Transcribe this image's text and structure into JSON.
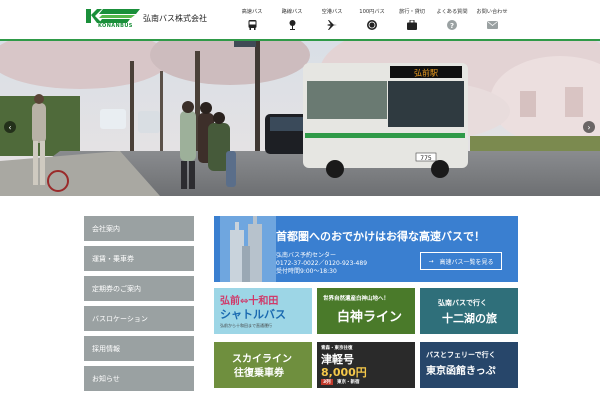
{
  "header": {
    "logo_text": "KONANBUS",
    "company_name": "弘南バス株式会社",
    "nav": [
      {
        "label": "高速バス",
        "icon": "bus-icon"
      },
      {
        "label": "路線バス",
        "icon": "bus-stop-icon"
      },
      {
        "label": "空港バス",
        "icon": "airplane-icon"
      },
      {
        "label": "100円バス",
        "icon": "coin-icon"
      },
      {
        "label": "旅行・貸切",
        "icon": "suitcase-icon"
      },
      {
        "label": "よくある質問",
        "icon": "question-icon"
      },
      {
        "label": "お問い合わせ",
        "icon": "envelope-icon"
      }
    ]
  },
  "hero": {
    "bus_destination": "弘前駅",
    "bus_number": "775",
    "arrow_left": "‹",
    "arrow_right": "›"
  },
  "sidebar": [
    "会社案内",
    "運賃・乗車券",
    "定期券のご案内",
    "バスロケーション",
    "採用情報",
    "お知らせ"
  ],
  "feature": {
    "title": "首都圏へのおでかけはお得な高速バスで！",
    "center": "弘南バス予約センター",
    "phone": "0172-37-0022／0120-923-489",
    "hours": "受付時間9:00～18:30",
    "button": "高速バス一覧を見る"
  },
  "tiles": [
    {
      "line1": "弘前⇔十和田",
      "line2": "シャトルバス",
      "line3": "弘前から十和田まで直通運行"
    },
    {
      "line1": "世界自然遺産白神山地へ！",
      "line2": "白神ライン"
    },
    {
      "line1": "弘南バスで行く",
      "line2": "十二湖の旅"
    },
    {
      "line1": "スカイライン",
      "line2": "往復乗車券"
    },
    {
      "line1": "青森・東京往復",
      "line2": "津軽号",
      "line3": "8,000円",
      "badge": "3列",
      "route": "東京・新宿"
    },
    {
      "line1": "バスとフェリーで行く",
      "line2": "東京函館きっぷ"
    }
  ],
  "colors": {
    "brand_green": "#2f9a48",
    "sidebar_gray": "#9aa1a2",
    "feature_blue": "#3a7fd0"
  }
}
